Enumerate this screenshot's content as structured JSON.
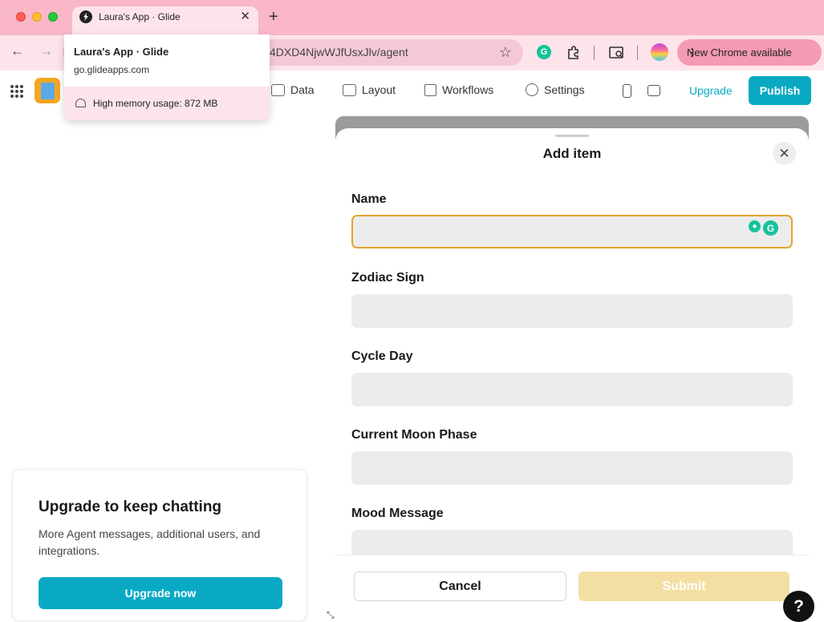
{
  "browser": {
    "tab_title": "Laura's App · Glide",
    "url_visible": "4DXD4NjwWJfUsxJlv/agent",
    "chrome_update_label": "New Chrome available",
    "new_tab_glyph": "+",
    "close_glyph": "✕"
  },
  "hover_card": {
    "title": "Laura's App · Glide",
    "domain": "go.glideapps.com",
    "memory": "High memory usage: 872 MB"
  },
  "header": {
    "nav": [
      {
        "label": "Data",
        "icon": "table-icon"
      },
      {
        "label": "Layout",
        "icon": "layout-icon"
      },
      {
        "label": "Workflows",
        "icon": "workflows-icon"
      },
      {
        "label": "Settings",
        "icon": "gear-icon"
      }
    ],
    "upgrade_label": "Upgrade",
    "publish_label": "Publish",
    "accent_color": "#0aa9c3"
  },
  "upgrade_card": {
    "title": "Upgrade to keep chatting",
    "body": "More Agent messages, additional users, and integrations.",
    "button_label": "Upgrade now"
  },
  "modal": {
    "title": "Add item",
    "fields": [
      {
        "label": "Name",
        "value": "",
        "focused": true
      },
      {
        "label": "Zodiac Sign",
        "value": ""
      },
      {
        "label": "Cycle Day",
        "value": ""
      },
      {
        "label": "Current Moon Phase",
        "value": ""
      },
      {
        "label": "Mood Message",
        "value": ""
      }
    ],
    "cancel_label": "Cancel",
    "submit_label": "Submit",
    "focus_color": "#e5a52d"
  },
  "help_label": "?"
}
